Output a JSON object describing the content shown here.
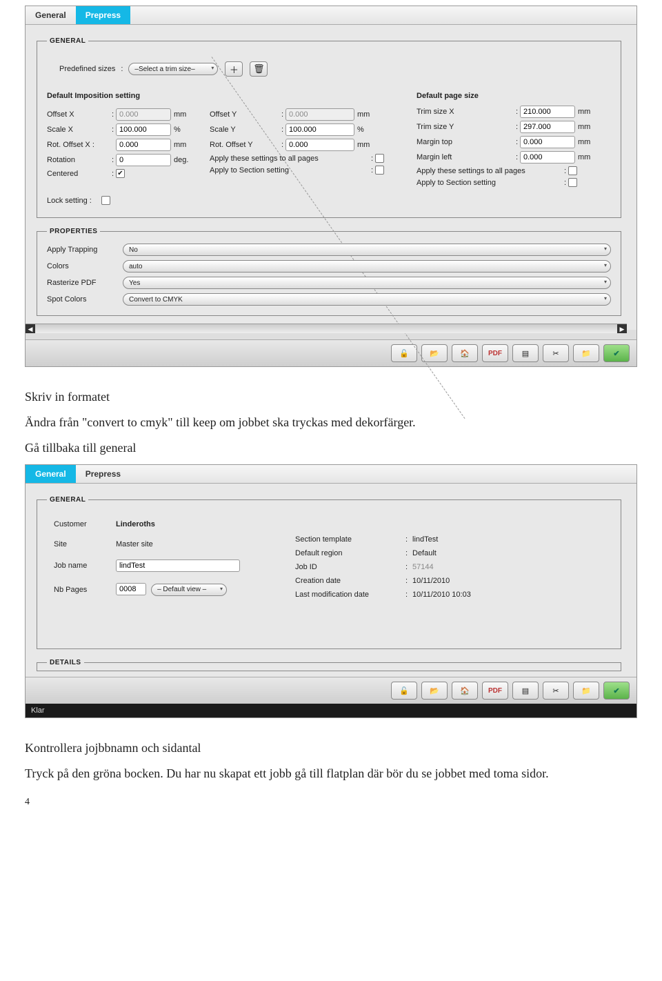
{
  "window1": {
    "tabs": {
      "general": "General",
      "prepress": "Prepress",
      "active": "prepress"
    },
    "general_group": "GENERAL",
    "predefined_sizes_label": "Predefined sizes",
    "predefined_sizes_select": "–Select a trim size–",
    "imposition_heading": "Default Imposition setting",
    "page_size_heading": "Default page size",
    "offset_x_label": "Offset X",
    "offset_x_value": "0.000",
    "mm": "mm",
    "offset_y_label": "Offset Y",
    "offset_y_value": "0.000",
    "scale_x_label": "Scale X",
    "scale_x_value": "100.000",
    "pct": "%",
    "scale_y_label": "Scale Y",
    "scale_y_value": "100.000",
    "rot_offset_x_label": "Rot. Offset X :",
    "rot_offset_x_value": "0.000",
    "rot_offset_y_label": "Rot. Offset Y",
    "rot_offset_y_value": "0.000",
    "rotation_label": "Rotation",
    "rotation_value": "0",
    "deg": "deg.",
    "apply_all_label": "Apply these settings to all pages",
    "centered_label": "Centered",
    "apply_section_label": "Apply to Section setting",
    "trim_x_label": "Trim size X",
    "trim_x_value": "210.000",
    "trim_y_label": "Trim size Y",
    "trim_y_value": "297.000",
    "margin_top_label": "Margin top",
    "margin_top_value": "0.000",
    "margin_left_label": "Margin left",
    "margin_left_value": "0.000",
    "lock_setting_label": "Lock setting :",
    "properties_group": "PROPERTIES",
    "apply_trapping_label": "Apply Trapping",
    "apply_trapping_value": "No",
    "colors_label": "Colors",
    "colors_value": "auto",
    "rasterize_label": "Rasterize PDF",
    "rasterize_value": "Yes",
    "spot_colors_label": "Spot Colors",
    "spot_colors_value": "Convert to CMYK",
    "toolbar": {
      "unlock": "🔓",
      "open": "📂",
      "home": "🏠",
      "pdf": "PDF",
      "layout": "▤",
      "tools": "✂",
      "folder": "📁",
      "ok": "✔"
    }
  },
  "doc": {
    "p1": "Skriv in formatet",
    "p2": "Ändra från \"convert to cmyk\" till keep om jobbet ska tryckas med dekorfärger.",
    "p3": "Gå tillbaka till general",
    "p4": "Kontrollera jojbbnamn och sidantal",
    "p5": "Tryck på den gröna bocken. Du har nu skapat ett jobb gå till flatplan där bör du se jobbet med toma sidor.",
    "pagenum": "4"
  },
  "window2": {
    "tabs": {
      "general": "General",
      "prepress": "Prepress",
      "active": "general"
    },
    "general_group": "GENERAL",
    "customer_label": "Customer",
    "customer_value": "Linderoths",
    "site_label": "Site",
    "site_value": "Master site",
    "job_name_label": "Job name",
    "job_name_value": "lindTest",
    "nb_pages_label": "Nb Pages",
    "nb_pages_value": "0008",
    "nb_pages_view": "– Default view –",
    "section_template_label": "Section template",
    "section_template_value": "lindTest",
    "default_region_label": "Default region",
    "default_region_value": "Default",
    "job_id_label": "Job ID",
    "job_id_value": "57144",
    "creation_date_label": "Creation date",
    "creation_date_value": "10/11/2010",
    "last_mod_label": "Last modification date",
    "last_mod_value": "10/11/2010 10:03",
    "details_group": "DETAILS",
    "status": "Klar"
  }
}
